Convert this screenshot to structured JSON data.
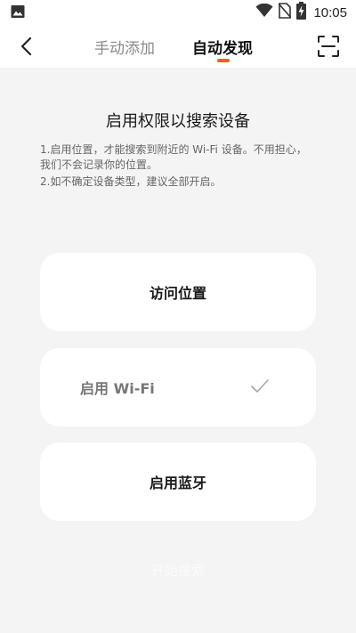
{
  "status_bar": {
    "time": "10:05"
  },
  "header": {
    "tabs": [
      {
        "label": "手动添加",
        "active": false
      },
      {
        "label": "自动发现",
        "active": true
      }
    ]
  },
  "main": {
    "title": "启用权限以搜索设备",
    "tips": [
      "1.启用位置，才能搜索到附近的 Wi-Fi 设备。不用担心，我们不会记录你的位置。",
      "2.如不确定设备类型，建议全部开启。"
    ],
    "permissions": [
      {
        "label": "访问位置",
        "enabled": false
      },
      {
        "label": "启用 Wi-Fi",
        "enabled": true
      },
      {
        "label": "启用蓝牙",
        "enabled": false
      }
    ],
    "start_button": "开始搜索"
  },
  "colors": {
    "accent": "#ff5722",
    "background": "#f4f4f4",
    "card": "#ffffff"
  },
  "icons": {
    "status_left": "image-icon",
    "status_right": [
      "wifi-icon",
      "no-sim-icon",
      "battery-charging-icon"
    ],
    "nav_left": "back-arrow-icon",
    "nav_right": "scan-icon",
    "wifi_card": "check-icon"
  }
}
